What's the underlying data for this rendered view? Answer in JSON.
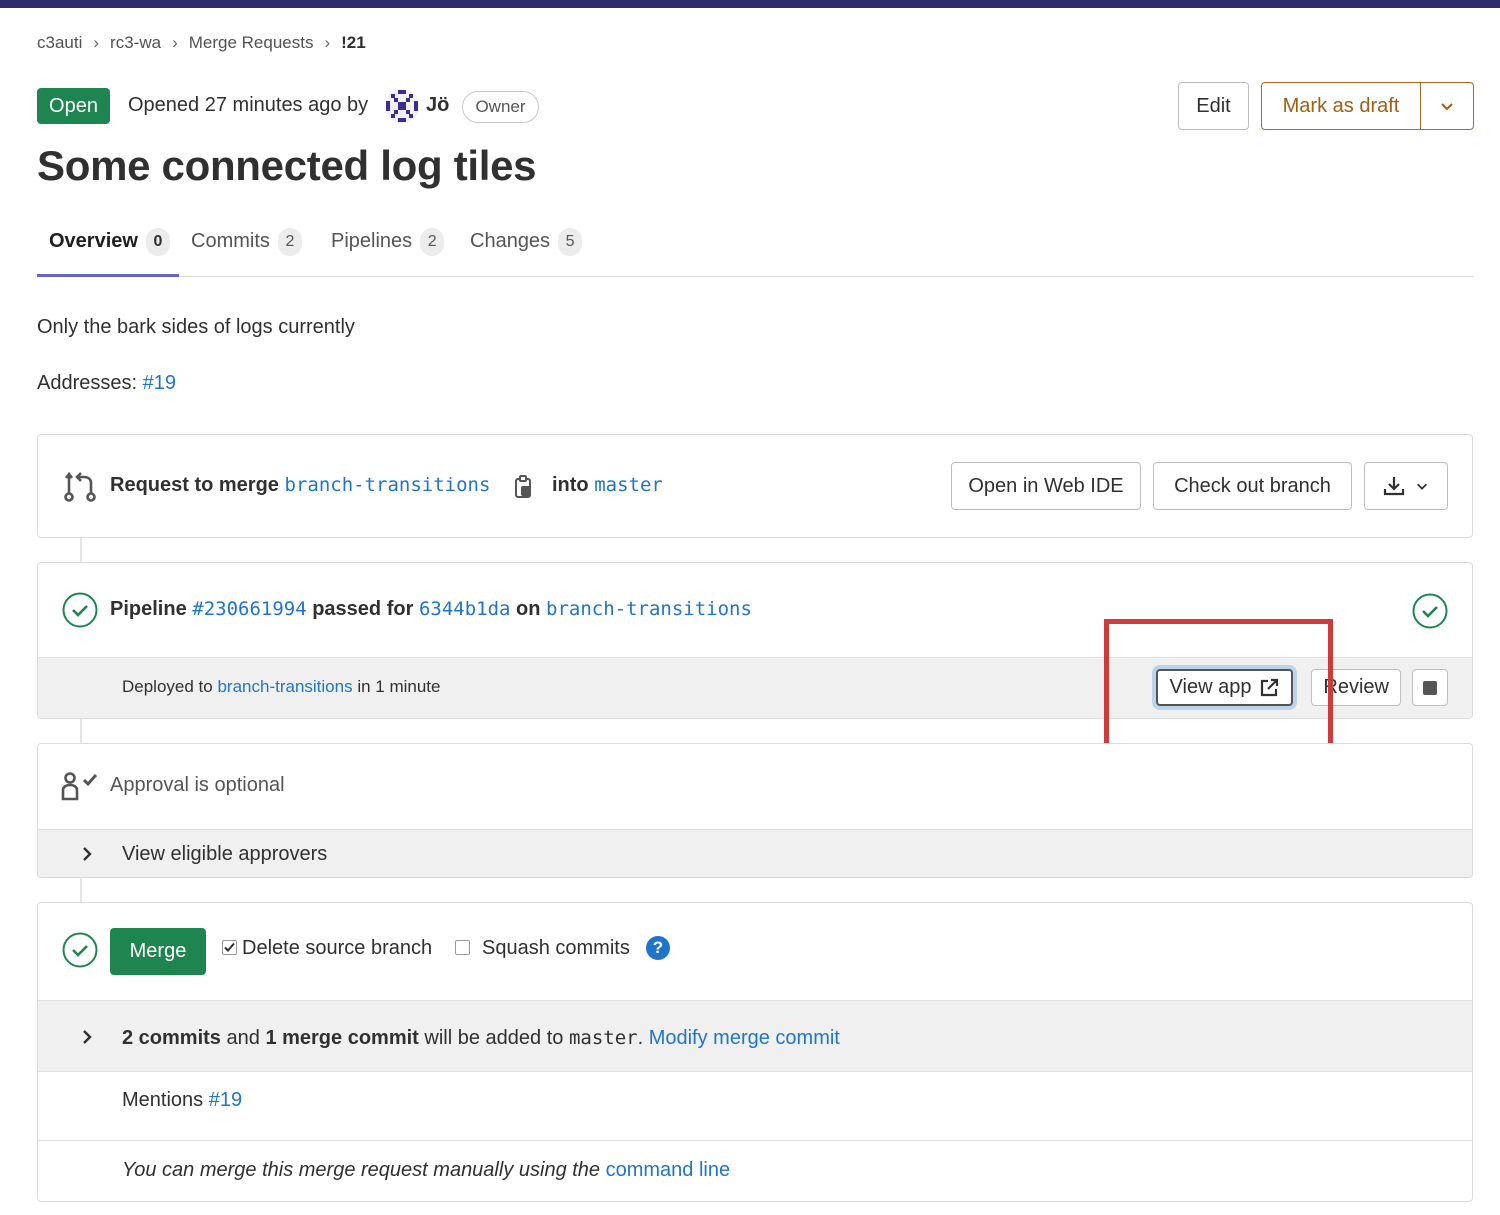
{
  "breadcrumb": {
    "items": [
      "c3auti",
      "rc3-wa",
      "Merge Requests",
      "!21"
    ]
  },
  "header": {
    "status": "Open",
    "opened_text": "Opened 27 minutes ago by",
    "author": "Jö",
    "author_role": "Owner",
    "edit_label": "Edit",
    "draft_label": "Mark as draft"
  },
  "title": "Some connected log tiles",
  "tabs": [
    {
      "label": "Overview",
      "count": "0"
    },
    {
      "label": "Commits",
      "count": "2"
    },
    {
      "label": "Pipelines",
      "count": "2"
    },
    {
      "label": "Changes",
      "count": "5"
    }
  ],
  "description": {
    "line1": "Only the bark sides of logs currently",
    "addresses_label": "Addresses:",
    "addresses_link": "#19"
  },
  "merge_request": {
    "prefix": "Request to merge",
    "source_branch": "branch-transitions",
    "into": "into",
    "target_branch": "master",
    "web_ide_label": "Open in Web IDE",
    "checkout_label": "Check out branch"
  },
  "pipeline": {
    "prefix": "Pipeline",
    "id": "#230661994",
    "passed_for": "passed for",
    "commit": "6344b1da",
    "on": "on",
    "branch": "branch-transitions",
    "deployed_prefix": "Deployed to",
    "deployed_env": "branch-transitions",
    "deployed_suffix": "in 1 minute",
    "view_app_label": "View app",
    "review_label": "Review"
  },
  "approval": {
    "text": "Approval is optional",
    "view_approvers": "View eligible approvers"
  },
  "merge_widget": {
    "merge_label": "Merge",
    "delete_source_label": "Delete source branch",
    "delete_source_checked": true,
    "squash_label": "Squash commits",
    "squash_checked": false,
    "help": "?",
    "commits_count": "2 commits",
    "and": "and",
    "merge_commit_count": "1 merge commit",
    "will_be_added": "will be added to",
    "target": "master",
    "period": ".",
    "modify_link": "Modify merge commit",
    "mentions_label": "Mentions",
    "mentions_link": "#19",
    "manual_text": "You can merge this merge request manually using the",
    "command_line_link": "command line"
  },
  "colors": {
    "accent": "#1f75cb",
    "success": "#1f8550",
    "warning": "#a35d0f",
    "highlight": "#cf3a3a"
  }
}
